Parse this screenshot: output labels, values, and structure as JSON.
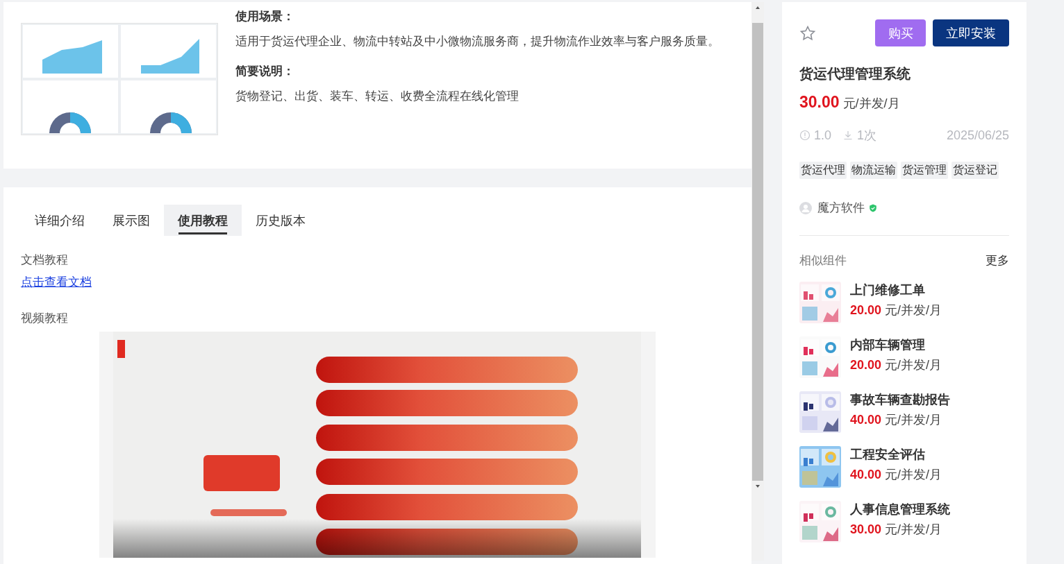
{
  "overview": {
    "sections": [
      {
        "heading": "使用场景：",
        "text": "适用于货运代理企业、物流中转站及中小微物流服务商，提升物流作业效率与客户服务质量。"
      },
      {
        "heading": "简要说明：",
        "text": "货物登记、出货、装车、转运、收费全流程在线化管理"
      }
    ]
  },
  "tabs": [
    {
      "label": "详细介绍",
      "selected": false
    },
    {
      "label": "展示图",
      "selected": false
    },
    {
      "label": "使用教程",
      "selected": true
    },
    {
      "label": "历史版本",
      "selected": false
    }
  ],
  "tutorial": {
    "doc_heading": "文档教程",
    "doc_link": "点击查看文档",
    "video_heading": "视频教程"
  },
  "product": {
    "favorited": false,
    "buttons": [
      {
        "label": "购买",
        "kind": "buy"
      },
      {
        "label": "立即安装",
        "kind": "install"
      }
    ],
    "title": "货运代理管理系统",
    "price": "30.00",
    "unit": "元/并发/月",
    "version": "1.0",
    "downloads": "1次",
    "date": "2025/06/25",
    "tags": [
      "货运代理",
      "物流运输",
      "货运管理",
      "货运登记"
    ],
    "author": "魔方软件",
    "verified": true
  },
  "similar": {
    "heading": "相似组件",
    "more": "更多",
    "items": [
      {
        "name": "上门维修工单",
        "price": "20.00",
        "unit": "元/并发/月"
      },
      {
        "name": "内部车辆管理",
        "price": "20.00",
        "unit": "元/并发/月"
      },
      {
        "name": "事故车辆查勘报告",
        "price": "40.00",
        "unit": "元/并发/月"
      },
      {
        "name": "工程安全评估",
        "price": "40.00",
        "unit": "元/并发/月"
      },
      {
        "name": "人事信息管理系统",
        "price": "30.00",
        "unit": "元/并发/月"
      }
    ]
  }
}
